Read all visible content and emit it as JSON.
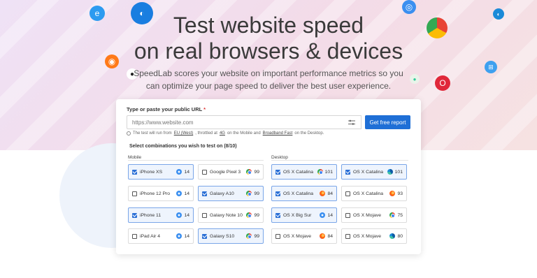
{
  "hero": {
    "title_line1": "Test website speed",
    "title_line2": "on real browsers & devices",
    "subtitle": "SpeedLab scores your website on important performance metrics so you can optimize your page speed to deliver the best user experience."
  },
  "form": {
    "url_label": "Type or paste your public URL",
    "required_mark": "*",
    "url_placeholder": "https://www.website.com",
    "url_value": "",
    "submit_label": "Get free report",
    "settings_icon": "sliders-icon",
    "note": {
      "prefix": "The test will run from",
      "region": "EU (West)",
      "mid1": ", throttled at",
      "mobile_net": "4G",
      "mid2": "on the Mobile and",
      "desktop_net": "Broadband Fast",
      "suffix": "on the Desktop."
    },
    "select_title": "Select combinations you wish to test on (8/10)",
    "mobile_label": "Mobile",
    "desktop_label": "Desktop"
  },
  "options": [
    {
      "name": "iPhone XS",
      "browser": "safari",
      "version": "14",
      "checked": true
    },
    {
      "name": "Google Pixel 3",
      "browser": "chrome",
      "version": "99",
      "checked": false
    },
    {
      "name": "OS X Catalina",
      "browser": "chrome",
      "version": "101",
      "checked": true
    },
    {
      "name": "OS X Catalina",
      "browser": "edge",
      "version": "101",
      "checked": true
    },
    {
      "name": "iPhone 12 Pro",
      "browser": "safari",
      "version": "14",
      "checked": false
    },
    {
      "name": "Galaxy A10",
      "browser": "chrome",
      "version": "99",
      "checked": true
    },
    {
      "name": "OS X Catalina",
      "browser": "firefox",
      "version": "84",
      "checked": true
    },
    {
      "name": "OS X Catalina",
      "browser": "firefox",
      "version": "93",
      "checked": false
    },
    {
      "name": "iPhone 11",
      "browser": "safari",
      "version": "14",
      "checked": true
    },
    {
      "name": "Galaxy Note 10",
      "browser": "chrome",
      "version": "99",
      "checked": false
    },
    {
      "name": "OS X Big Sur",
      "browser": "safari",
      "version": "14",
      "checked": true
    },
    {
      "name": "OS X Mojave",
      "browser": "chrome",
      "version": "75",
      "checked": false
    },
    {
      "name": "iPad Air 4",
      "browser": "safari",
      "version": "14",
      "checked": false
    },
    {
      "name": "Galaxy S10",
      "browser": "chrome",
      "version": "99",
      "checked": true
    },
    {
      "name": "OS X Mojave",
      "browser": "firefox",
      "version": "84",
      "checked": false
    },
    {
      "name": "OS X Mojave",
      "browser": "edge",
      "version": "80",
      "checked": false
    }
  ],
  "decor_icons": [
    "ie-rocket-icon",
    "edge-rocket-icon",
    "firefox-rocket-icon",
    "apple-rocket-icon",
    "safari-rocket-icon",
    "chrome-rocket-icon",
    "opera-rocket-icon",
    "windows-rocket-icon",
    "android-rocket-icon"
  ]
}
